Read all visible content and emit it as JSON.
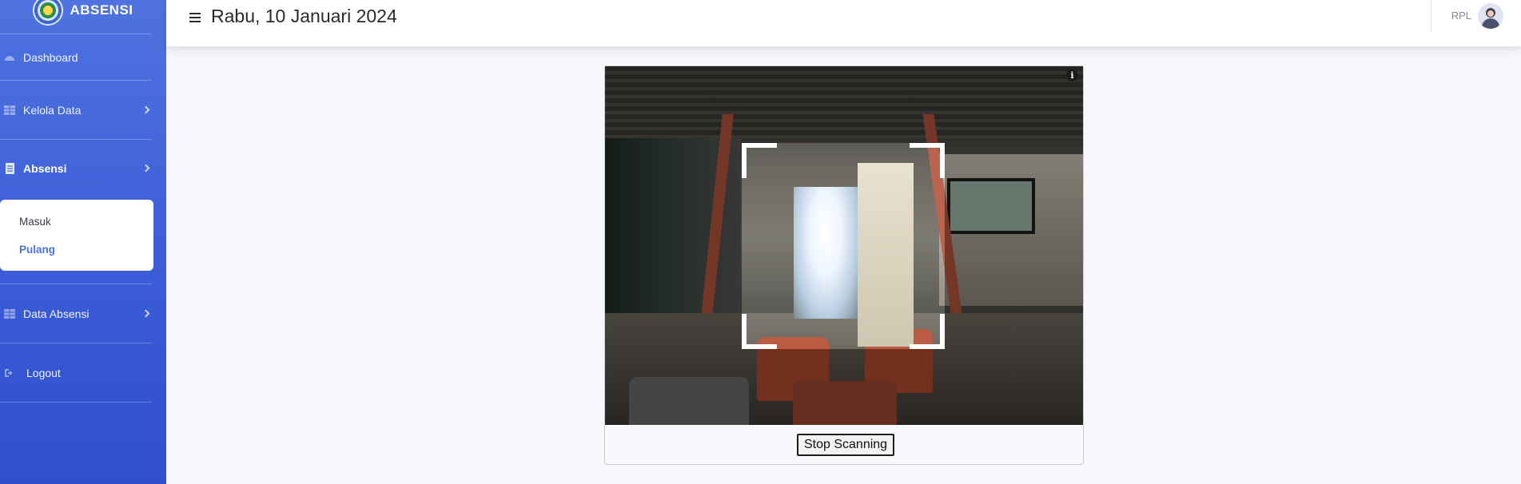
{
  "sidebar": {
    "brand": "ABSENSI",
    "items": [
      {
        "label": "Dashboard",
        "icon": "tachometer-icon"
      },
      {
        "label": "Kelola Data",
        "icon": "table-icon"
      },
      {
        "label": "Absensi",
        "icon": "clipboard-icon"
      },
      {
        "label": "Data Absensi",
        "icon": "table-icon"
      },
      {
        "label": "Logout",
        "icon": "sign-out-icon"
      }
    ],
    "absensi_submenu": [
      "Masuk",
      "Pulang"
    ],
    "active_submenu": "Pulang"
  },
  "topbar": {
    "date": "Rabu, 10 Januari 2024",
    "user": "RPL"
  },
  "scanner": {
    "stop_label": "Stop Scanning",
    "info": "i"
  },
  "colors": {
    "sidebar_top": "#4e73df",
    "sidebar_bottom": "#2f4fcf",
    "active_link": "#4e73df",
    "background": "#f6f7fb"
  }
}
